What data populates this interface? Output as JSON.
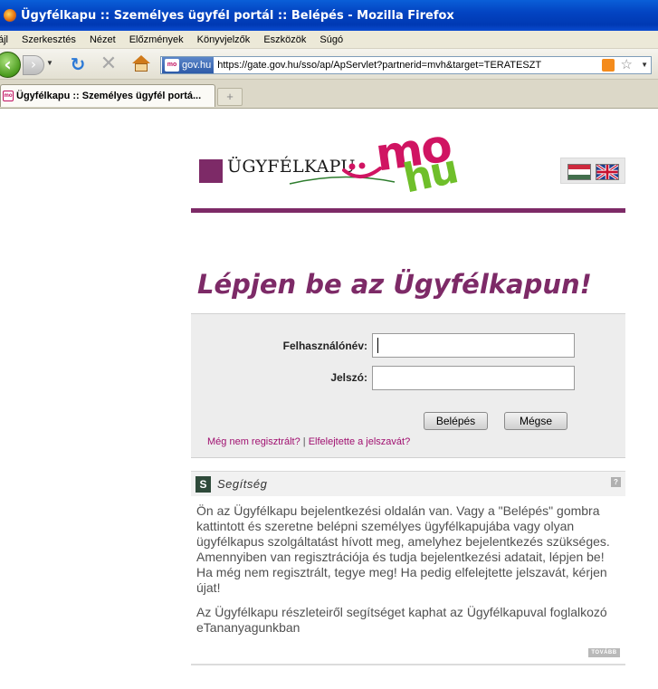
{
  "browser": {
    "window_title": "Ügyfélkapu :: Személyes ügyfél portál :: Belépés - Mozilla Firefox",
    "menu": [
      "ájl",
      "Szerkesztés",
      "Nézet",
      "Előzmények",
      "Könyvjelzők",
      "Eszközök",
      "Súgó"
    ],
    "identity_label": "gov.hu",
    "url": "https://gate.gov.hu/sso/ap/ApServlet?partnerid=mvh&target=TERATESZT",
    "tab_title": "Ügyfélkapu :: Személyes ügyfél portá...",
    "new_tab_symbol": "+",
    "favicon_text": "mo",
    "icons": [
      "back-icon",
      "forward-icon",
      "reload-icon",
      "stop-icon",
      "home-icon",
      "rss-icon",
      "star-icon"
    ]
  },
  "header": {
    "brand": "ÜGYFÉLKAPU",
    "logo_mo": "mo",
    "logo_hu": "hu",
    "brand_color": "#7d2a67"
  },
  "login": {
    "title": "Lépjen be az Ügyfélkapun!",
    "username_label": "Felhasználónév:",
    "password_label": "Jelszó:",
    "username_value": "",
    "password_value": "",
    "login_button": "Belépés",
    "cancel_button": "Mégse",
    "register_link": "Még nem regisztrált?",
    "link_separator": "|",
    "forgot_link": "Elfelejtette a jelszavát?"
  },
  "help": {
    "badge": "S",
    "title": "Segítség",
    "q_mark": "?",
    "paragraph1": "Ön az Ügyfélkapu bejelentkezési oldalán van. Vagy a \"Belépés\" gombra kattintott és szeretne belépni személyes ügyfélkapujába vagy olyan ügyfélkapus szolgáltatást hívott meg, amelyhez bejelentkezés szükséges. Amennyiben van regisztrációja és tudja bejelentkezési adatait, lépjen be! Ha még nem regisztrált, tegye meg! Ha pedig elfelejtette jelszavát, kérjen újat!",
    "paragraph2": "Az Ügyfélkapu részleteiről segítséget kaphat az Ügyfélkapuval foglalkozó eTananyagunkban",
    "more": "TOVÁBB"
  }
}
